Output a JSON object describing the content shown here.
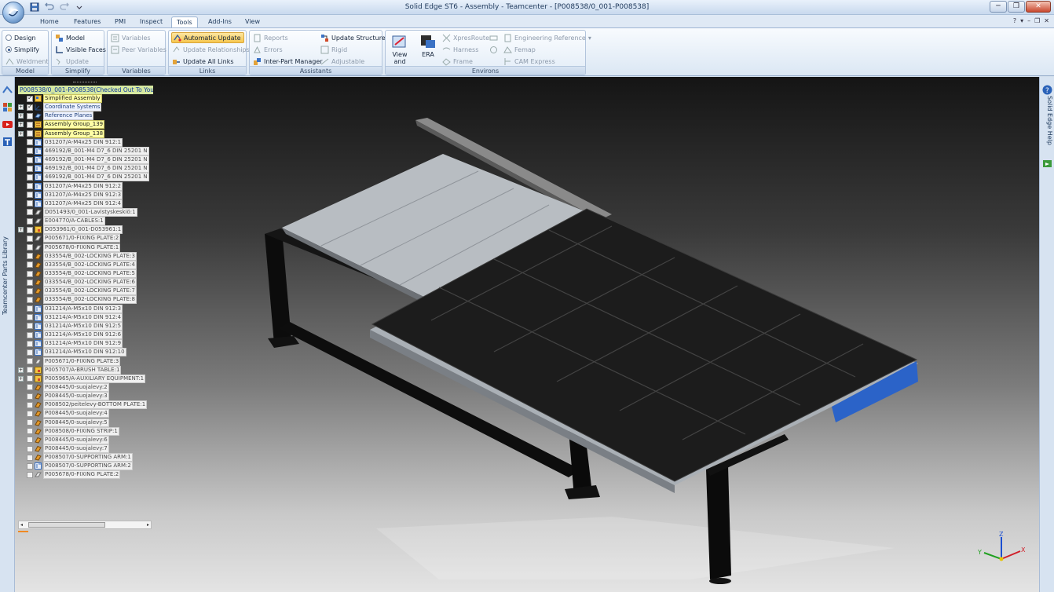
{
  "window": {
    "title": "Solid Edge ST6 - Assembly - Teamcenter - [P008538/0_001-P008538]"
  },
  "ribbon_tabs": [
    {
      "label": "Home"
    },
    {
      "label": "Features"
    },
    {
      "label": "PMI"
    },
    {
      "label": "Inspect"
    },
    {
      "label": "Tools",
      "active": true
    },
    {
      "label": "Add-Ins"
    },
    {
      "label": "View"
    }
  ],
  "groups": {
    "model": {
      "label": "Model",
      "design": "Design",
      "simplify": "Simplify",
      "weldment": "Weldment",
      "selected": "Simplify"
    },
    "simplify": {
      "label": "Simplify",
      "model": "Model",
      "visible_faces": "Visible Faces",
      "update": "Update"
    },
    "variables": {
      "label": "Variables",
      "variables": "Variables",
      "peer_variables": "Peer Variables"
    },
    "links": {
      "label": "Links",
      "automatic_update": "Automatic Update",
      "update_relationships": "Update Relationships",
      "update_all_links": "Update All Links"
    },
    "assistants": {
      "label": "Assistants",
      "reports": "Reports",
      "errors": "Errors",
      "inter_part_manager": "Inter-Part Manager",
      "update_structure": "Update Structure",
      "rigid": "Rigid",
      "adjustable": "Adjustable"
    },
    "environs": {
      "label": "Environs",
      "view_and_markup": "View and Markup",
      "era": "ERA",
      "xpresroute": "XpresRoute",
      "harness": "Harness",
      "frame": "Frame",
      "engineering_reference": "Engineering Reference",
      "femap": "Femap",
      "cam_express": "CAM Express"
    }
  },
  "left_strip": {
    "library_label": "Teamcenter Parts Library"
  },
  "right_strip": {
    "help_label": "Solid Edge Help"
  },
  "tree": {
    "root": "P008538/0_001-P008538(Checked Out To You)",
    "items": [
      {
        "label": "Simplified Assembly",
        "exp": "",
        "checked": true,
        "icon": "simplified-assembly-icon",
        "hl": true
      },
      {
        "label": "Coordinate Systems",
        "exp": "+",
        "checked": true,
        "icon": "coordinate-system-icon",
        "fw": true
      },
      {
        "label": "Reference Planes",
        "exp": "+",
        "checked": false,
        "icon": "reference-plane-icon",
        "fw": true
      },
      {
        "label": "Assembly Group_139",
        "exp": "+",
        "checked": false,
        "icon": "assembly-group-icon",
        "hl": true
      },
      {
        "label": "Assembly Group_138",
        "exp": "+",
        "checked": false,
        "icon": "assembly-group-icon",
        "hl": true
      },
      {
        "label": "031207/A-M4x25 DIN 912:1",
        "exp": "",
        "checked": false,
        "icon": "fastener-part-icon"
      },
      {
        "label": "469192/B_001-M4 D7_6 DIN 25201 N",
        "exp": "",
        "checked": false,
        "icon": "fastener-part-icon"
      },
      {
        "label": "469192/B_001-M4 D7_6 DIN 25201 N",
        "exp": "",
        "checked": false,
        "icon": "fastener-part-icon"
      },
      {
        "label": "469192/B_001-M4 D7_6 DIN 25201 N",
        "exp": "",
        "checked": false,
        "icon": "fastener-part-icon"
      },
      {
        "label": "469192/B_001-M4 D7_6 DIN 25201 N",
        "exp": "",
        "checked": false,
        "icon": "fastener-part-icon"
      },
      {
        "label": "031207/A-M4x25 DIN 912:2",
        "exp": "",
        "checked": false,
        "icon": "fastener-part-icon"
      },
      {
        "label": "031207/A-M4x25 DIN 912:3",
        "exp": "",
        "checked": false,
        "icon": "fastener-part-icon"
      },
      {
        "label": "031207/A-M4x25 DIN 912:4",
        "exp": "",
        "checked": false,
        "icon": "fastener-part-icon"
      },
      {
        "label": "D051493/0_001-Lavistyskeskiö:1",
        "exp": "",
        "checked": false,
        "icon": "sheet-part-icon"
      },
      {
        "label": "E004770/A-CABLES:1",
        "exp": "",
        "checked": false,
        "icon": "sheet-part-icon"
      },
      {
        "label": "D053961/0_001-D053961:1",
        "exp": "+",
        "checked": false,
        "icon": "subassembly-icon"
      },
      {
        "label": "P005671/0-FIXING PLATE:2",
        "exp": "",
        "checked": false,
        "icon": "sheet-part-icon"
      },
      {
        "label": "P005678/0-FIXING PLATE:1",
        "exp": "",
        "checked": false,
        "icon": "sheet-part-icon"
      },
      {
        "label": "033554/B_002-LOCKING PLATE:3",
        "exp": "",
        "checked": false,
        "icon": "part-icon"
      },
      {
        "label": "033554/B_002-LOCKING PLATE:4",
        "exp": "",
        "checked": false,
        "icon": "part-icon"
      },
      {
        "label": "033554/B_002-LOCKING PLATE:5",
        "exp": "",
        "checked": false,
        "icon": "part-icon"
      },
      {
        "label": "033554/B_002-LOCKING PLATE:6",
        "exp": "",
        "checked": false,
        "icon": "part-icon"
      },
      {
        "label": "033554/B_002-LOCKING PLATE:7",
        "exp": "",
        "checked": false,
        "icon": "part-icon"
      },
      {
        "label": "033554/B_002-LOCKING PLATE:8",
        "exp": "",
        "checked": false,
        "icon": "part-icon"
      },
      {
        "label": "031214/A-M5x10 DIN 912:3",
        "exp": "",
        "checked": false,
        "icon": "fastener-part-icon"
      },
      {
        "label": "031214/A-M5x10 DIN 912:4",
        "exp": "",
        "checked": false,
        "icon": "fastener-part-icon"
      },
      {
        "label": "031214/A-M5x10 DIN 912:5",
        "exp": "",
        "checked": false,
        "icon": "fastener-part-icon"
      },
      {
        "label": "031214/A-M5x10 DIN 912:6",
        "exp": "",
        "checked": false,
        "icon": "fastener-part-icon"
      },
      {
        "label": "031214/A-M5x10 DIN 912:9",
        "exp": "",
        "checked": false,
        "icon": "fastener-part-icon"
      },
      {
        "label": "031214/A-M5x10 DIN 912:10",
        "exp": "",
        "checked": false,
        "icon": "fastener-part-icon"
      },
      {
        "label": "P005671/0-FIXING PLATE:3",
        "exp": "",
        "checked": false,
        "icon": "sheet-part-icon"
      },
      {
        "label": "P005707/A-BRUSH TABLE:1",
        "exp": "+",
        "checked": false,
        "icon": "subassembly-icon"
      },
      {
        "label": "P005965/A-AUXILIARY EQUIPMENT:1",
        "exp": "+",
        "checked": false,
        "icon": "subassembly-icon"
      },
      {
        "label": "P008445/0-suojalevy:2",
        "exp": "",
        "checked": false,
        "icon": "part-icon"
      },
      {
        "label": "P008445/0-suojalevy:3",
        "exp": "",
        "checked": false,
        "icon": "part-icon"
      },
      {
        "label": "P008502/peitelevy-BOTTOM PLATE:1",
        "exp": "",
        "checked": false,
        "icon": "part-icon"
      },
      {
        "label": "P008445/0-suojalevy:4",
        "exp": "",
        "checked": false,
        "icon": "part-icon"
      },
      {
        "label": "P008445/0-suojalevy:5",
        "exp": "",
        "checked": false,
        "icon": "part-icon"
      },
      {
        "label": "P008508/0-FIXING STRIP:1",
        "exp": "",
        "checked": false,
        "icon": "part-icon"
      },
      {
        "label": "P008445/0-suojalevy:6",
        "exp": "",
        "checked": false,
        "icon": "part-icon"
      },
      {
        "label": "P008445/0-suojalevy:7",
        "exp": "",
        "checked": false,
        "icon": "part-icon"
      },
      {
        "label": "P008507/0-SUPPORTING ARM:1",
        "exp": "",
        "checked": false,
        "icon": "part-icon"
      },
      {
        "label": "P008507/0-SUPPORTING ARM:2",
        "exp": "",
        "checked": false,
        "icon": "fastener-part-icon"
      },
      {
        "label": "P005678/0-FIXING PLATE:2",
        "exp": "",
        "checked": false,
        "icon": "sheet-part-icon"
      }
    ]
  },
  "triad": {
    "x": "X",
    "y": "Y",
    "z": "Z"
  },
  "colors": {
    "accent": "#f6c64e",
    "frame": "#0b0b0b",
    "mat": "#1d1d1d",
    "plate": "#c8c8c8",
    "edge_blue": "#2b63c8"
  }
}
